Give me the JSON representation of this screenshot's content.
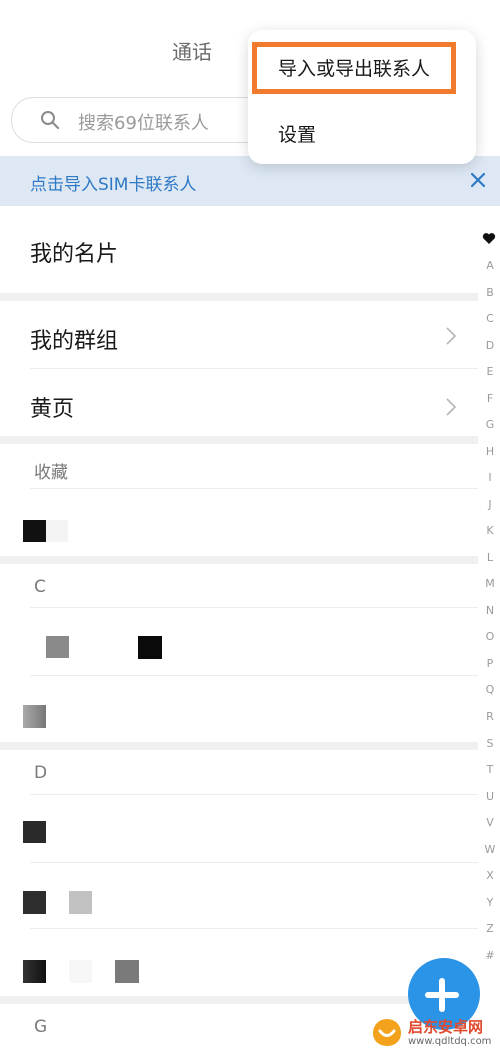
{
  "header": {
    "tab_calls": "通话"
  },
  "search": {
    "placeholder": "搜索69位联系人"
  },
  "menu": {
    "import_export": "导入或导出联系人",
    "settings": "设置"
  },
  "sim_banner": {
    "text": "点击导入SIM卡联系人"
  },
  "rows": {
    "my_card": "我的名片",
    "my_groups": "我的群组",
    "yellow_pages": "黄页"
  },
  "sections": {
    "favorites": "收藏",
    "c": "C",
    "d": "D",
    "g": "G"
  },
  "alphabet": [
    "A",
    "B",
    "C",
    "D",
    "E",
    "F",
    "G",
    "H",
    "I",
    "J",
    "K",
    "L",
    "M",
    "N",
    "O",
    "P",
    "Q",
    "R",
    "S",
    "T",
    "U",
    "V",
    "W",
    "X",
    "Y",
    "Z",
    "#"
  ],
  "watermark": {
    "brand": "启东安卓网",
    "url": "www.qdltdq.com"
  },
  "colors": {
    "accent_blue": "#2b94e6",
    "highlight_orange": "#f07a2e",
    "banner_text": "#2f79c5",
    "banner_bg": "#dde8f4"
  }
}
